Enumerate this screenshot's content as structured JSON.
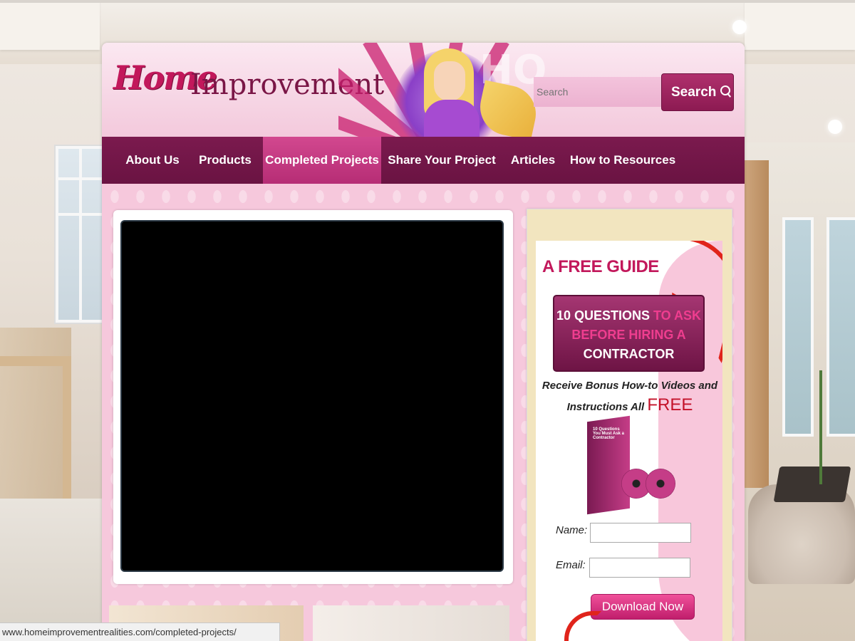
{
  "header": {
    "logo_home": "Home",
    "logo_improvement": "Improvement",
    "hero_letters": "HO",
    "search_placeholder": "Search",
    "search_button": "Search"
  },
  "nav": {
    "items": [
      {
        "label": "About Us"
      },
      {
        "label": "Products"
      },
      {
        "label": "Completed Projects",
        "active": true
      },
      {
        "label": "Share Your Project"
      },
      {
        "label": "Articles"
      },
      {
        "label": "How to Resources"
      }
    ]
  },
  "guide": {
    "title": "A FREE GUIDE",
    "q_line1_white": "10 QUESTIONS",
    "q_line1_pink": "TO ASK",
    "q_line2_pink": "BEFORE HIRING A",
    "q_line3_white": "CONTRACTOR",
    "bonus_line1": "Receive Bonus How-to Videos and",
    "bonus_line2": "Instructions All",
    "bonus_free": "FREE",
    "product_title": "10 Questions You Must Ask a Contractor",
    "name_label": "Name:",
    "email_label": "Email:",
    "download_button": "Download Now"
  },
  "status_url": "www.homeimprovementrealities.com/completed-projects/",
  "colors": {
    "brand": "#c2185b",
    "nav_bg": "#7b1a4e",
    "nav_active": "#d2488f",
    "accent_red": "#e0241b"
  }
}
